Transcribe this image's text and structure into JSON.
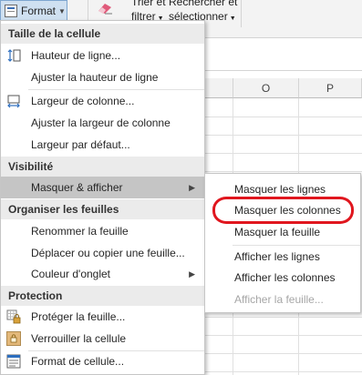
{
  "ribbon": {
    "format_label": "Format",
    "sort_label_line1": "Trier et",
    "sort_label_line2": "filtrer",
    "search_label_line1": "Rechercher et",
    "search_label_line2": "sélectionner"
  },
  "grid": {
    "columns": [
      "O",
      "P"
    ]
  },
  "menu": {
    "sections": [
      {
        "header": "Taille de la cellule",
        "items": [
          {
            "label": "Hauteur de ligne...",
            "icon": "row-height-icon"
          },
          {
            "label": "Ajuster la hauteur de ligne",
            "icon": ""
          },
          {
            "label": "Largeur de colonne...",
            "icon": "column-width-icon"
          },
          {
            "label": "Ajuster la largeur de colonne",
            "icon": ""
          },
          {
            "label": "Largeur par défaut...",
            "icon": ""
          }
        ]
      },
      {
        "header": "Visibilité",
        "items": [
          {
            "label": "Masquer & afficher",
            "icon": "",
            "submenu": true,
            "highlighted": true
          }
        ]
      },
      {
        "header": "Organiser les feuilles",
        "items": [
          {
            "label": "Renommer la feuille",
            "icon": ""
          },
          {
            "label": "Déplacer ou copier une feuille...",
            "icon": ""
          },
          {
            "label": "Couleur d'onglet",
            "icon": "",
            "submenu": true
          }
        ]
      },
      {
        "header": "Protection",
        "items": [
          {
            "label": "Protéger la feuille...",
            "icon": "protect-sheet-icon"
          },
          {
            "label": "Verrouiller la cellule",
            "icon": "lock-cell-icon"
          },
          {
            "label": "Format de cellule...",
            "icon": "format-cells-icon"
          }
        ]
      }
    ]
  },
  "submenu": {
    "items": [
      {
        "label": "Masquer les lignes",
        "disabled": false
      },
      {
        "label": "Masquer les colonnes",
        "disabled": false,
        "circled": true
      },
      {
        "label": "Masquer la feuille",
        "disabled": false
      },
      {
        "label": "Afficher les lignes",
        "disabled": false
      },
      {
        "label": "Afficher les colonnes",
        "disabled": false
      },
      {
        "label": "Afficher la feuille...",
        "disabled": true
      }
    ]
  },
  "colors": {
    "highlight": "#c5c5c5",
    "section_bg": "#ebebeb",
    "annotation_ring": "#e0161e",
    "disabled_text": "#a6a6a6"
  }
}
